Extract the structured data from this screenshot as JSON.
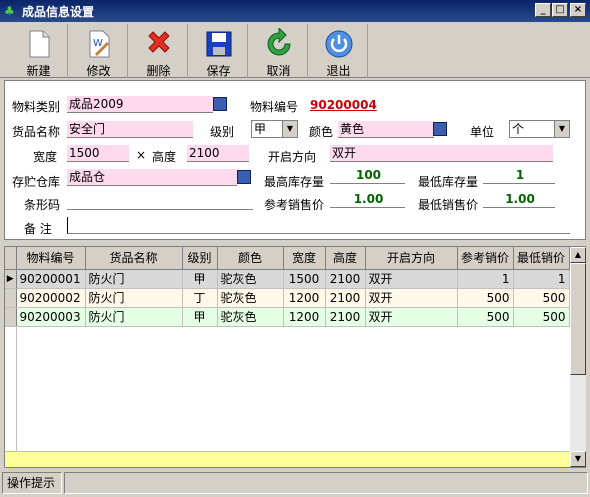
{
  "window": {
    "title": "成品信息设置",
    "min": "_",
    "max": "□",
    "close": "×"
  },
  "toolbar": {
    "new": "新建",
    "edit": "修改",
    "delete": "删除",
    "save": "保存",
    "cancel": "取消",
    "exit": "退出"
  },
  "form": {
    "category_label": "物料类别",
    "category_value": "成品2009",
    "code_label": "物料编号",
    "code_value": "90200004",
    "name_label": "货品名称",
    "name_value": "安全门",
    "grade_label": "级别",
    "grade_value": "甲",
    "color_label": "颜色",
    "color_value": "黄色",
    "unit_label": "单位",
    "unit_value": "个",
    "width_label": "宽度",
    "width_value": "1500",
    "times": "×",
    "height_label": "高度",
    "height_value": "2100",
    "direction_label": "开启方向",
    "direction_value": "双开",
    "warehouse_label": "存贮仓库",
    "warehouse_value": "成品仓",
    "maxstock_label": "最高库存量",
    "maxstock_value": "100",
    "minstock_label": "最低库存量",
    "minstock_value": "1",
    "barcode_label": "条形码",
    "barcode_value": "",
    "refprice_label": "参考销售价",
    "refprice_value": "1.00",
    "minprice_label": "最低销售价",
    "minprice_value": "1.00",
    "note_label": "备 注",
    "note_value": ""
  },
  "grid": {
    "columns": [
      "物料编号",
      "货品名称",
      "级别",
      "颜色",
      "宽度",
      "高度",
      "开启方向",
      "参考销价",
      "最低销价"
    ],
    "rows": [
      [
        "90200001",
        "防火门",
        "甲",
        "驼灰色",
        "1500",
        "2100",
        "双开",
        "1",
        "1"
      ],
      [
        "90200002",
        "防火门",
        "丁",
        "驼灰色",
        "1200",
        "2100",
        "双开",
        "500",
        "500"
      ],
      [
        "90200003",
        "防火门",
        "甲",
        "驼灰色",
        "1200",
        "2100",
        "双开",
        "500",
        "500"
      ]
    ],
    "current_marker": "▶"
  },
  "status": {
    "hint": "操作提示",
    "message": ""
  },
  "colors": {
    "titlebar": "#0a246a",
    "pink_field": "#ffd9ee",
    "code_red": "#cc0000",
    "stock_green": "#006400",
    "footer_yellow": "#ffff99"
  }
}
